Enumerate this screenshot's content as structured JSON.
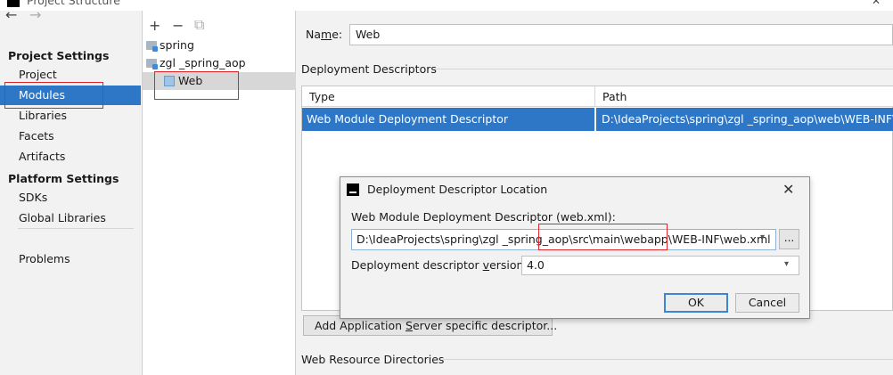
{
  "window": {
    "title": "Project Structure",
    "close": "✕"
  },
  "nav": {
    "back": "←",
    "forward": "→",
    "project_settings_header": "Project Settings",
    "project_settings": [
      "Project",
      "Modules",
      "Libraries",
      "Facets",
      "Artifacts"
    ],
    "platform_settings_header": "Platform Settings",
    "platform_settings": [
      "SDKs",
      "Global Libraries"
    ],
    "problems": "Problems",
    "selected": "Modules"
  },
  "tree": {
    "toolbar": {
      "add": "+",
      "remove": "−",
      "copy": "⧉"
    },
    "items": [
      {
        "label": "spring",
        "icon": "module-folder-icon"
      },
      {
        "label": "zgl _spring_aop",
        "icon": "module-folder-icon"
      },
      {
        "label": "Web",
        "icon": "web-facet-icon",
        "selected": true
      }
    ]
  },
  "main": {
    "name_label_pre": "Na",
    "name_label_mnemonic": "m",
    "name_label_post": "e:",
    "name_value": "Web",
    "deployment_descriptors_title": "Deployment Descriptors",
    "columns": {
      "type": "Type",
      "path": "Path"
    },
    "rows": [
      {
        "type": "Web Module Deployment Descriptor",
        "path": "D:\\IdeaProjects\\spring\\zgl _spring_aop\\web\\WEB-INF\\web.xml"
      }
    ],
    "add_button_pre": "Add Application ",
    "add_button_mnemonic": "S",
    "add_button_post": "erver specific descriptor...",
    "web_resource_title": "Web Resource Directories"
  },
  "dialog": {
    "title": "Deployment Descriptor Location",
    "close": "✕",
    "descriptor_label": "Web Module Deployment Descriptor (web.xml):",
    "descriptor_path": "D:\\IdeaProjects\\spring\\zgl _spring_aop\\src\\main\\webapp\\WEB-INF\\web.xml",
    "browse": "...",
    "version_label_pre": "Deployment descriptor ",
    "version_label_mnemonic": "v",
    "version_label_post": "ersion",
    "version_value": "4.0",
    "ok": "OK",
    "cancel": "Cancel"
  },
  "colors": {
    "selection": "#2e77c6",
    "highlight_annotation": "#e2232a"
  }
}
